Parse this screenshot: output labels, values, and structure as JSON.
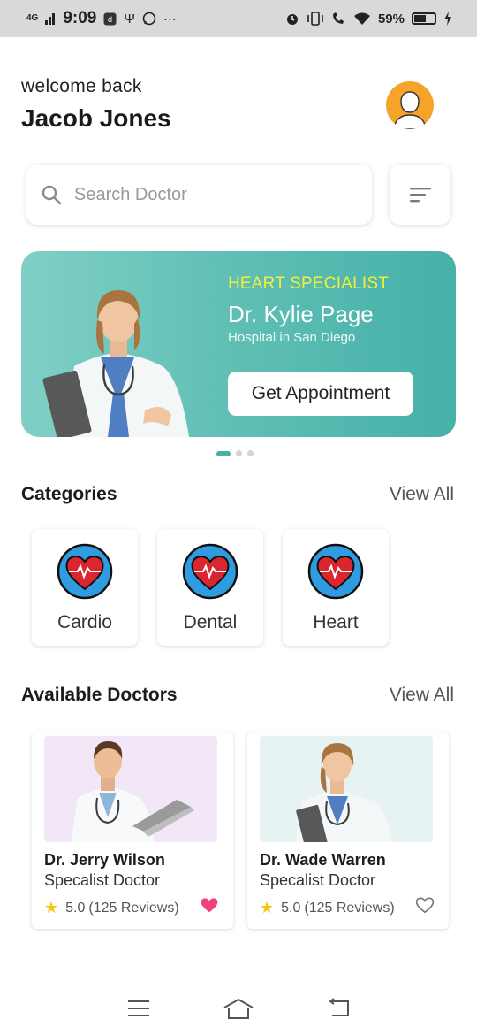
{
  "status_bar": {
    "network": "4G",
    "time": "9:09",
    "battery_percent": "59%",
    "battery_level": 0.59,
    "icons": [
      "signal-icon",
      "usb-icon",
      "whatsapp-icon",
      "more-dots-icon",
      "alarm-icon",
      "vibrate-icon",
      "wifi-call-icon",
      "wifi-icon",
      "battery-icon",
      "charging-icon"
    ],
    "more": "···"
  },
  "header": {
    "greeting": "welcome back",
    "user_name": "Jacob Jones",
    "avatar_color": "#f5a42a"
  },
  "search": {
    "placeholder": "Search Doctor",
    "value": ""
  },
  "banner": {
    "specialty": "HEART SPECIALIST",
    "doctor_name": "Dr. Kylie Page",
    "hospital": "Hospital in San Diego",
    "button_label": "Get Appointment",
    "slides": 3,
    "active_slide": 1
  },
  "categories": {
    "title": "Categories",
    "view_all": "View All",
    "items": [
      {
        "label": "Cardio",
        "icon": "heartbeat-icon"
      },
      {
        "label": "Dental",
        "icon": "heartbeat-icon"
      },
      {
        "label": "Heart",
        "icon": "heartbeat-icon"
      }
    ]
  },
  "doctors": {
    "title": "Available Doctors",
    "view_all": "View All",
    "items": [
      {
        "name": "Dr. Jerry Wilson",
        "specialty": "Specalist Doctor",
        "rating": "5.0",
        "reviews": "(125 Reviews)",
        "favorite": true
      },
      {
        "name": "Dr. Wade Warren",
        "specialty": "Specalist Doctor",
        "rating": "5.0",
        "reviews": "(125 Reviews)",
        "favorite": false
      }
    ]
  },
  "colors": {
    "accent": "#45b1a8",
    "banner_highlight": "#f2ef3c",
    "favorite": "#f0427a",
    "star": "#f4c514"
  }
}
